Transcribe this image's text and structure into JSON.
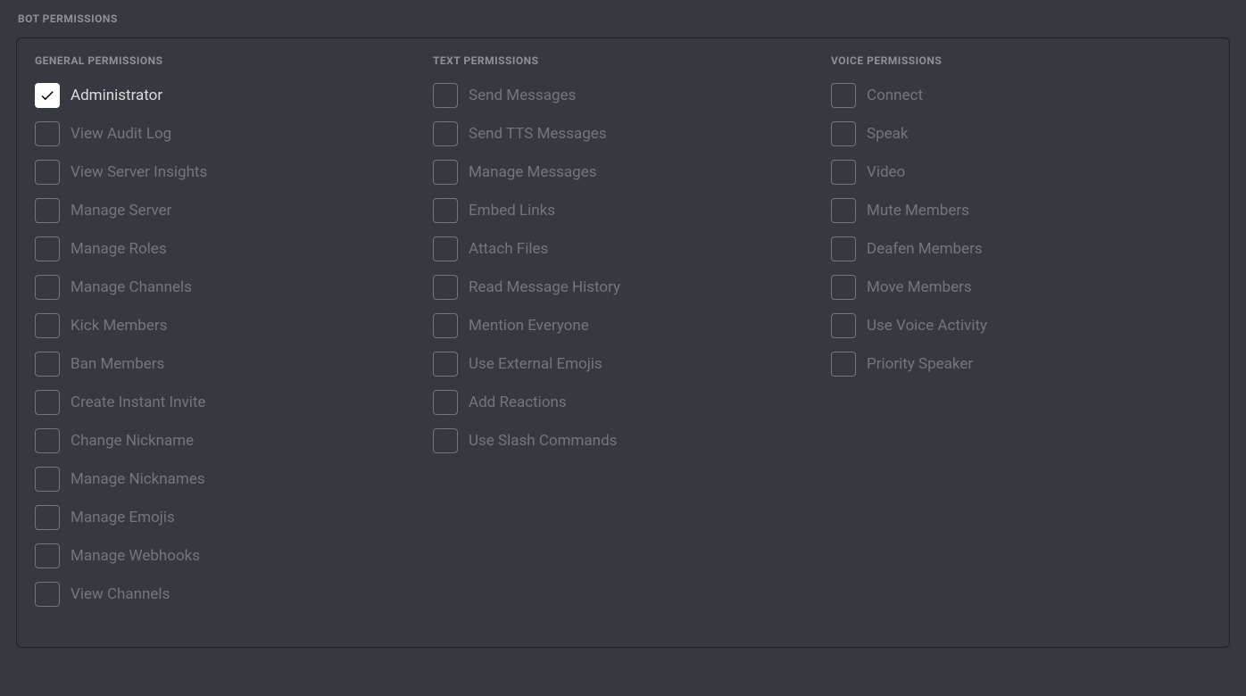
{
  "title": "BOT PERMISSIONS",
  "columns": [
    {
      "header": "GENERAL PERMISSIONS",
      "items": [
        {
          "label": "Administrator",
          "checked": true
        },
        {
          "label": "View Audit Log",
          "checked": false
        },
        {
          "label": "View Server Insights",
          "checked": false
        },
        {
          "label": "Manage Server",
          "checked": false
        },
        {
          "label": "Manage Roles",
          "checked": false
        },
        {
          "label": "Manage Channels",
          "checked": false
        },
        {
          "label": "Kick Members",
          "checked": false
        },
        {
          "label": "Ban Members",
          "checked": false
        },
        {
          "label": "Create Instant Invite",
          "checked": false
        },
        {
          "label": "Change Nickname",
          "checked": false
        },
        {
          "label": "Manage Nicknames",
          "checked": false
        },
        {
          "label": "Manage Emojis",
          "checked": false
        },
        {
          "label": "Manage Webhooks",
          "checked": false
        },
        {
          "label": "View Channels",
          "checked": false
        }
      ]
    },
    {
      "header": "TEXT PERMISSIONS",
      "items": [
        {
          "label": "Send Messages",
          "checked": false
        },
        {
          "label": "Send TTS Messages",
          "checked": false
        },
        {
          "label": "Manage Messages",
          "checked": false
        },
        {
          "label": "Embed Links",
          "checked": false
        },
        {
          "label": "Attach Files",
          "checked": false
        },
        {
          "label": "Read Message History",
          "checked": false
        },
        {
          "label": "Mention Everyone",
          "checked": false
        },
        {
          "label": "Use External Emojis",
          "checked": false
        },
        {
          "label": "Add Reactions",
          "checked": false
        },
        {
          "label": "Use Slash Commands",
          "checked": false
        }
      ]
    },
    {
      "header": "VOICE PERMISSIONS",
      "items": [
        {
          "label": "Connect",
          "checked": false
        },
        {
          "label": "Speak",
          "checked": false
        },
        {
          "label": "Video",
          "checked": false
        },
        {
          "label": "Mute Members",
          "checked": false
        },
        {
          "label": "Deafen Members",
          "checked": false
        },
        {
          "label": "Move Members",
          "checked": false
        },
        {
          "label": "Use Voice Activity",
          "checked": false
        },
        {
          "label": "Priority Speaker",
          "checked": false
        }
      ]
    }
  ]
}
